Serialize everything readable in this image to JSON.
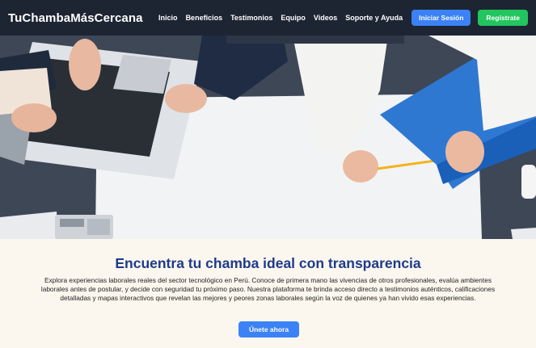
{
  "nav": {
    "brand": "TuChambaMásCercana",
    "links": [
      "Inicio",
      "Beneficios",
      "Testimonios",
      "Equipo",
      "Videos",
      "Soporte y Ayuda"
    ],
    "login_label": "Iniciar Sesión",
    "register_label": "Regístrate"
  },
  "hero": {
    "image": "business-meeting-desk-photo"
  },
  "main": {
    "headline": "Encuentra tu chamba ideal con transparencia",
    "description": "Explora experiencias laborales reales del sector tecnológico en Perú. Conoce de primera mano las vivencias de otros profesionales, evalúa ambientes laborales antes de postular, y decide con seguridad tu próximo paso. Nuestra plataforma te brinda acceso directo a testimonios auténticos, calificaciones detalladas y mapas interactivos que revelan las mejores y peores zonas laborales según la voz de quienes ya han vivido esas experiencias.",
    "cta_label": "Únete ahora"
  },
  "colors": {
    "navbar": "#1d2533",
    "primary": "#3b82f6",
    "success": "#22c55e",
    "headline": "#1e3a8a",
    "background": "#fbf7ef"
  }
}
